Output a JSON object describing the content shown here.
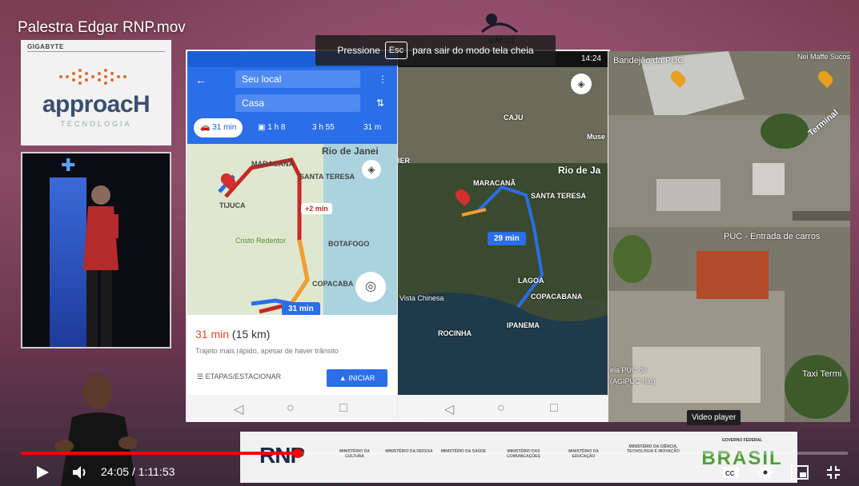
{
  "video": {
    "title": "Palestra Edgar RNP.mov",
    "current_time": "24:05",
    "separator": " / ",
    "duration": "1:11:53",
    "progress_fraction": 0.335
  },
  "fullscreen_notice": {
    "prefix": "Pressione",
    "key": "Esc",
    "suffix": "para sair do modo tela cheia"
  },
  "tooltip": "Video player",
  "sponsor": {
    "header": "GIGABYTE",
    "name": "approacH",
    "subtitle": "TECNOLOGIA"
  },
  "phone_maps": {
    "status_time": "14:24",
    "origin": "Seu local",
    "destination": "Casa",
    "tabs": [
      "31 min",
      "1 h 8",
      "3 h 55",
      "31 m"
    ],
    "map_labels": [
      "Rio de Janei",
      "MARACANÃ",
      "SANTA TERESA",
      "TIJUCA",
      "Cristo Redentor",
      "BOTAFOGO",
      "COPACABA"
    ],
    "delay_badge": "+2 min",
    "route_badge": "31 min",
    "summary_time": "31 min",
    "summary_distance": "(15 km)",
    "summary_desc": "Trajeto mais rápido, apesar de haver trânsito",
    "steps_label": "ETAPAS/ESTACIONAR",
    "start_label": "INICIAR"
  },
  "satellite_map": {
    "labels": [
      "CAJU",
      "Muse",
      "Rio de Ja",
      "MARACANÃ",
      "SANTA TERESA",
      "LAGOA",
      "COPACABANA",
      "Vista Chinesa",
      "ROCINHA",
      "IPANEMA",
      "IER"
    ],
    "route_badge": "29 min"
  },
  "aerial": {
    "labels": [
      "Bandejão da PUC",
      "Nei Maffe Sucos",
      "Terminal",
      "PUC - Entrada de carros",
      "ela PUC de",
      "(AGIPUC Rio)",
      "Taxi Termi"
    ]
  },
  "footer": {
    "rnp": "RNP",
    "ministries": [
      "MINISTÉRIO DA CULTURA",
      "MINISTÉRIO DA DEFESA",
      "MINISTÉRIO DA SAÚDE",
      "MINISTÉRIO DAS COMUNICAÇÕES",
      "MINISTÉRIO DA EDUCAÇÃO",
      "MINISTÉRIO DA CIÊNCIA, TECNOLOGIA E INOVAÇÃO"
    ],
    "gov_label": "GOVERNO FEDERAL",
    "brasil": "BRASIL"
  },
  "icons": {
    "play": "play-icon",
    "volume": "volume-icon",
    "captions": "captions-icon",
    "settings": "gear-icon",
    "miniplayer": "miniplayer-icon",
    "exit_fullscreen": "exit-fullscreen-icon"
  },
  "colors": {
    "progress": "#ff0000",
    "maps_blue": "#2a6ee8"
  }
}
